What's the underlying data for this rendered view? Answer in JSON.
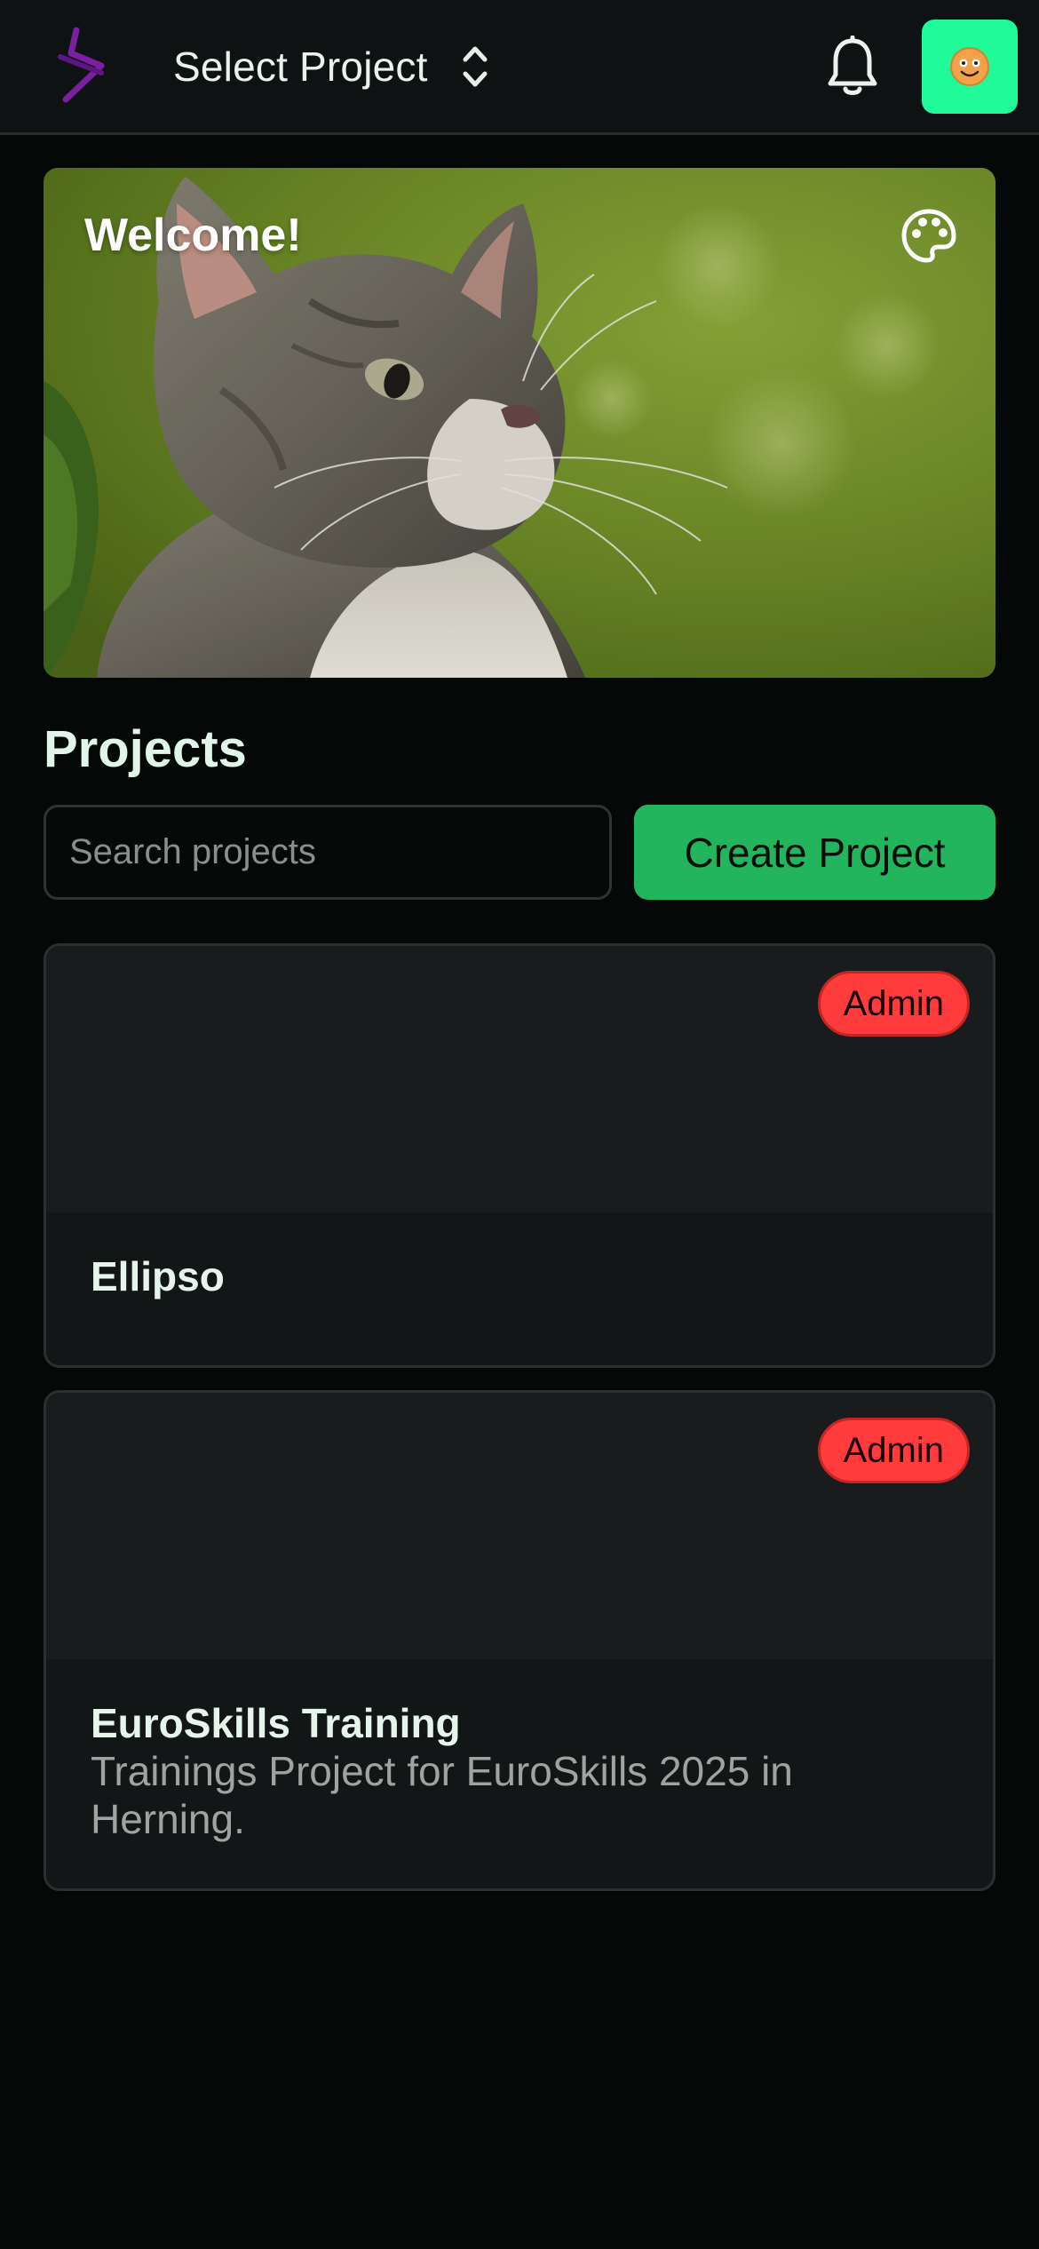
{
  "header": {
    "logo_icon": "lightning-cross-logo",
    "project_select_label": "Select Project",
    "project_select_icon": "chevron-up-down-icon",
    "notifications_icon": "bell-icon",
    "avatar_icon": "smiley-avatar",
    "avatar_color": "#1efb98"
  },
  "banner": {
    "title": "Welcome!",
    "palette_icon": "palette-icon"
  },
  "projects": {
    "heading": "Projects",
    "search_placeholder": "Search projects",
    "search_value": "",
    "create_label": "Create Project",
    "create_color": "#22b55e",
    "items": [
      {
        "name": "Ellipso",
        "description": "",
        "role": "Admin"
      },
      {
        "name": "EuroSkills Training",
        "description": "Trainings Project for EuroSkills 2025 in Herning.",
        "role": "Admin"
      }
    ]
  }
}
